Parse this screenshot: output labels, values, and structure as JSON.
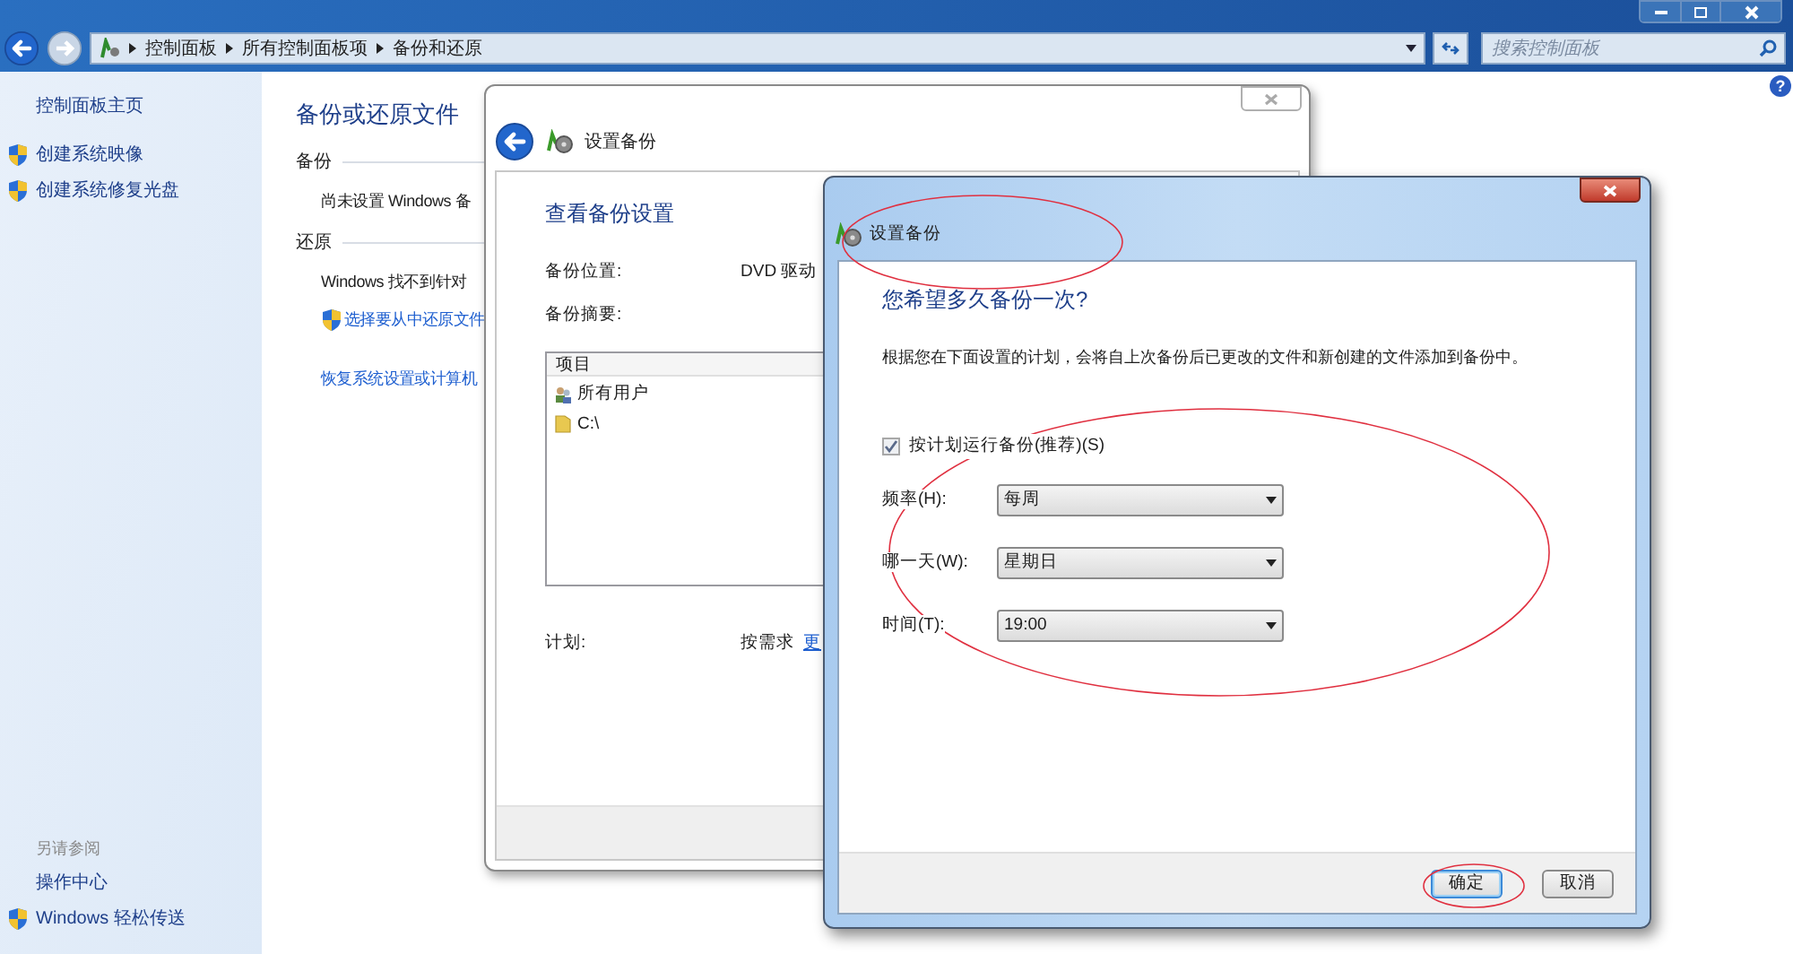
{
  "window": {
    "breadcrumb": [
      "控制面板",
      "所有控制面板项",
      "备份和还原"
    ],
    "search": {
      "placeholder": "搜索控制面板"
    },
    "help": "?"
  },
  "sidebar": {
    "home": "控制面板主页",
    "tasks": [
      {
        "label": "创建系统映像",
        "shield": true
      },
      {
        "label": "创建系统修复光盘",
        "shield": true
      }
    ],
    "see_also_title": "另请参阅",
    "see_also": [
      {
        "label": "操作中心",
        "shield": false
      },
      {
        "label": "Windows 轻松传送",
        "shield": true
      }
    ]
  },
  "main": {
    "title": "备份或还原文件",
    "sections": [
      {
        "heading": "备份",
        "items": [
          {
            "kind": "text",
            "text": "尚未设置 Windows 备"
          }
        ]
      },
      {
        "heading": "还原",
        "items": [
          {
            "kind": "text",
            "text": "Windows 找不到针对"
          },
          {
            "kind": "shield_link",
            "text": "选择要从中还原文件"
          }
        ]
      }
    ],
    "recover_link": "恢复系统设置或计算机"
  },
  "wizard": {
    "title": "设置备份",
    "heading": "查看备份设置",
    "location_label": "备份位置:",
    "location_value": "DVD 驱动",
    "summary_label": "备份摘要:",
    "summary_column": "项目",
    "summary_items": [
      {
        "kind": "users",
        "name": "所有用户"
      },
      {
        "kind": "folder",
        "name": "C:\\"
      }
    ],
    "schedule_label": "计划:",
    "schedule_value": "按需求",
    "schedule_link": "更"
  },
  "dialog": {
    "title": "设置备份",
    "heading": "您希望多久备份一次?",
    "description": "根据您在下面设置的计划，会将自上次备份后已更改的文件和新创建的文件添加到备份中。",
    "schedule_checkbox": {
      "label": "按计划运行备份(推荐)(S)",
      "checked": true
    },
    "fields": [
      {
        "label": "频率(H):",
        "value": "每周"
      },
      {
        "label": "哪一天(W):",
        "value": "星期日"
      },
      {
        "label": "时间(T):",
        "value": "19:00"
      }
    ],
    "buttons": [
      {
        "label": "确定",
        "default": true
      },
      {
        "label": "取消",
        "default": false
      }
    ]
  }
}
